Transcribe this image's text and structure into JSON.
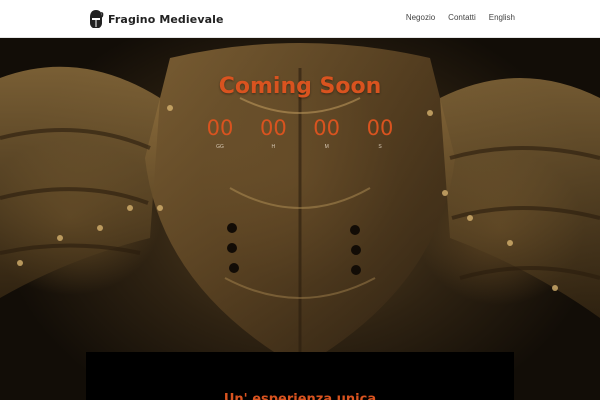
{
  "brand": {
    "name": "Fragino Medievale",
    "logo_icon": "knight-helmet-icon"
  },
  "nav": {
    "items": [
      "Negozio",
      "Contatti",
      "English"
    ]
  },
  "hero": {
    "title": "Coming Soon",
    "countdown": [
      {
        "value": "00",
        "label": "GG"
      },
      {
        "value": "00",
        "label": "H"
      },
      {
        "value": "00",
        "label": "M"
      },
      {
        "value": "00",
        "label": "S"
      }
    ],
    "background": "armor-breastplate-photo"
  },
  "panel": {
    "title": "Un' esperienza unica"
  },
  "colors": {
    "accent": "#d9531f",
    "header_bg": "#ffffff",
    "panel_bg": "#000000"
  }
}
